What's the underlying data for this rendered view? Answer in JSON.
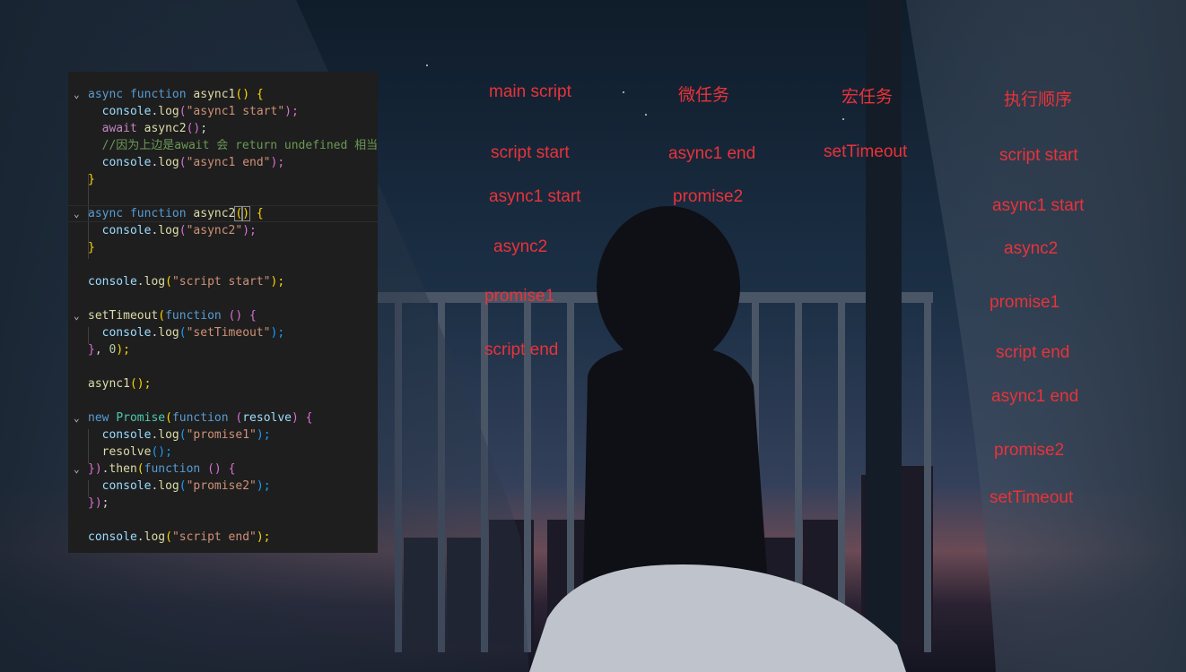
{
  "colors": {
    "annotation": "#e8333a",
    "editor_bg": "#1e1e1e"
  },
  "columns": {
    "main_script": {
      "header": "main script",
      "items": [
        "script start",
        "async1 start",
        "async2",
        "promise1",
        "script end"
      ]
    },
    "microtasks": {
      "header": "微任务",
      "items": [
        "async1 end",
        "promise2"
      ]
    },
    "macrotasks": {
      "header": "宏任务",
      "items": [
        "setTimeout"
      ]
    },
    "execution_order": {
      "header": "执行顺序",
      "items": [
        "script start",
        "async1 start",
        "async2",
        "promise1",
        "script end",
        "async1 end",
        "promise2",
        "setTimeout"
      ]
    }
  },
  "code": {
    "line1": {
      "a": "async",
      "b": "function",
      "c": "async1",
      "d": "(",
      "e": ")",
      "f": " {"
    },
    "line2": {
      "a": "console",
      "b": ".",
      "c": "log",
      "d": "(",
      "e": "\"async1 start\"",
      "f": ");"
    },
    "line3": {
      "a": "await",
      "b": "async2",
      "c": "()",
      "d": ";"
    },
    "line4": {
      "a": "//因为上边是await 会 return undefined 相当"
    },
    "line5": {
      "a": "console",
      "b": ".",
      "c": "log",
      "d": "(",
      "e": "\"async1 end\"",
      "f": ");"
    },
    "line6": {
      "a": "}"
    },
    "line8": {
      "a": "async",
      "b": "function",
      "c": "async2",
      "d": "(",
      "e": ")",
      "f": " {"
    },
    "line9": {
      "a": "console",
      "b": ".",
      "c": "log",
      "d": "(",
      "e": "\"async2\"",
      "f": ");"
    },
    "line10": {
      "a": "}"
    },
    "line12": {
      "a": "console",
      "b": ".",
      "c": "log",
      "d": "(",
      "e": "\"script start\"",
      "f": ");"
    },
    "line14": {
      "a": "setTimeout",
      "b": "(",
      "c": "function",
      "d": " () ",
      "e": "{"
    },
    "line15": {
      "a": "console",
      "b": ".",
      "c": "log",
      "d": "(",
      "e": "\"setTimeout\"",
      "f": ");"
    },
    "line16": {
      "a": "}",
      "b": ", ",
      "c": "0",
      "d": ");"
    },
    "line18": {
      "a": "async1",
      "b": "();"
    },
    "line20": {
      "a": "new",
      "b": "Promise",
      "c": "(",
      "d": "function",
      "e": " (",
      "f": "resolve",
      "g": ") ",
      "h": "{"
    },
    "line21": {
      "a": "console",
      "b": ".",
      "c": "log",
      "d": "(",
      "e": "\"promise1\"",
      "f": ");"
    },
    "line22": {
      "a": "resolve",
      "b": "();"
    },
    "line23": {
      "a": "})",
      "b": ".",
      "c": "then",
      "d": "(",
      "e": "function",
      "f": " () ",
      "g": "{"
    },
    "line24": {
      "a": "console",
      "b": ".",
      "c": "log",
      "d": "(",
      "e": "\"promise2\"",
      "f": ");"
    },
    "line25": {
      "a": "})",
      "b": ";"
    },
    "line27": {
      "a": "console",
      "b": ".",
      "c": "log",
      "d": "(",
      "e": "\"script end\"",
      "f": ");"
    }
  }
}
